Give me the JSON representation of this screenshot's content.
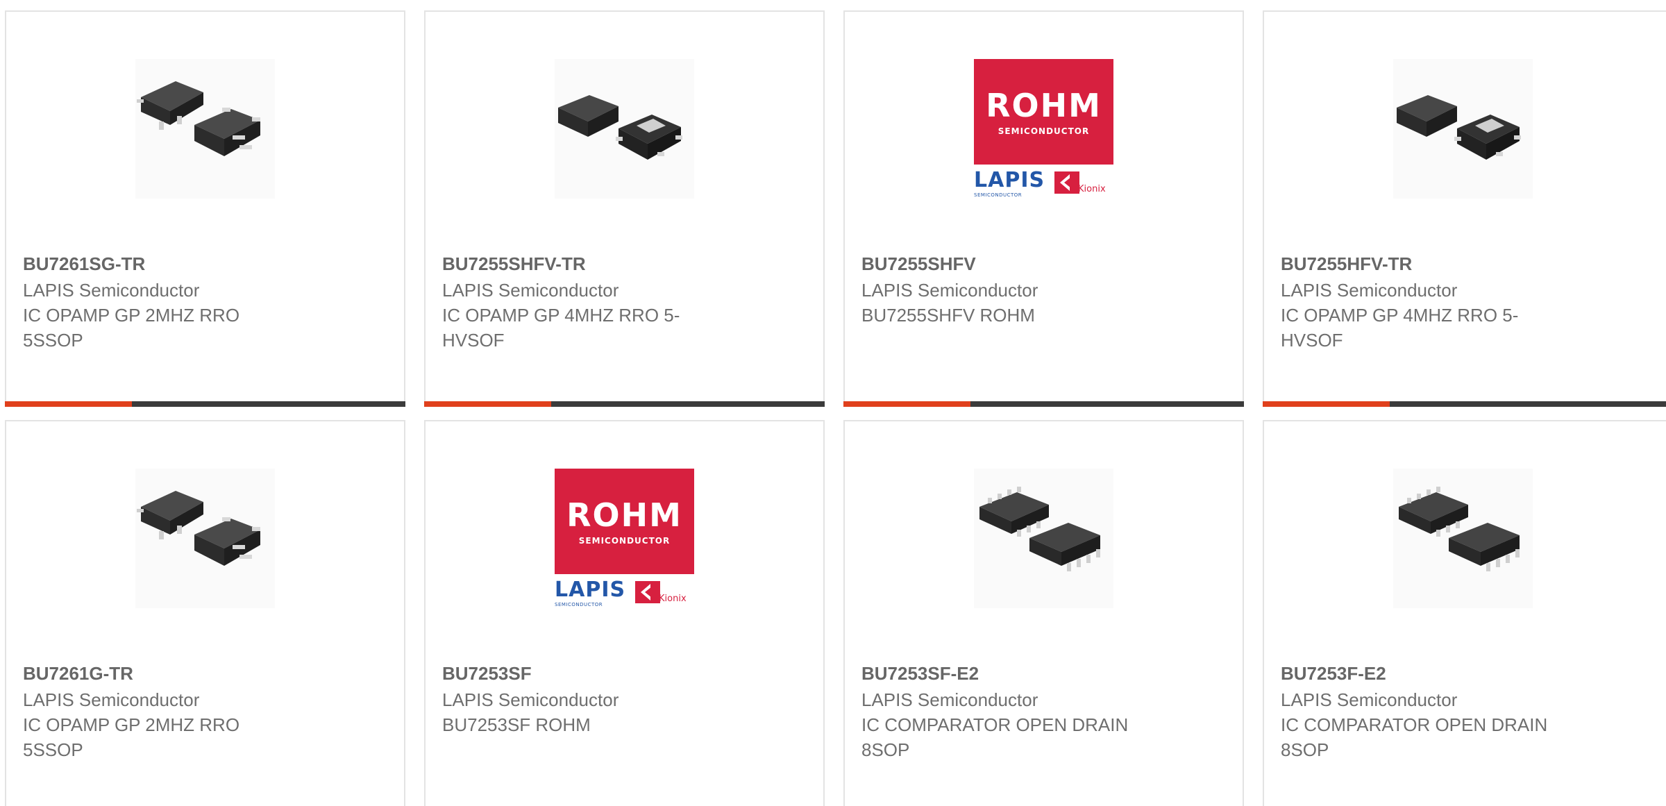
{
  "products": [
    {
      "part": "BU7261SG-TR",
      "manufacturer": "LAPIS Semiconductor",
      "description": "IC OPAMP GP 2MHZ RRO 5SSOP",
      "image": "sot23-5-chip-icon"
    },
    {
      "part": "BU7255SHFV-TR",
      "manufacturer": "LAPIS Semiconductor",
      "description": "IC OPAMP GP 4MHZ RRO 5-HVSOF",
      "image": "hvsof-5-chip-icon"
    },
    {
      "part": "BU7255SHFV",
      "manufacturer": "LAPIS Semiconductor",
      "description": "BU7255SHFV ROHM",
      "image": "rohm-logo"
    },
    {
      "part": "BU7255HFV-TR",
      "manufacturer": "LAPIS Semiconductor",
      "description": "IC OPAMP GP 4MHZ RRO 5-HVSOF",
      "image": "hvsof-5-chip-icon"
    },
    {
      "part": "BU7261G-TR",
      "manufacturer": "LAPIS Semiconductor",
      "description": "IC OPAMP GP 2MHZ RRO 5SSOP",
      "image": "sot23-5-chip-icon"
    },
    {
      "part": "BU7253SF",
      "manufacturer": "LAPIS Semiconductor",
      "description": "BU7253SF ROHM",
      "image": "rohm-logo"
    },
    {
      "part": "BU7253SF-E2",
      "manufacturer": "LAPIS Semiconductor",
      "description": "IC COMPARATOR OPEN DRAIN 8SOP",
      "image": "sop-8-chip-icon"
    },
    {
      "part": "BU7253F-E2",
      "manufacturer": "LAPIS Semiconductor",
      "description": "IC COMPARATOR OPEN DRAIN 8SOP",
      "image": "sop-8-chip-icon"
    }
  ],
  "logo": {
    "rohm": "ROHM",
    "semiconductor": "SEMICONDUCTOR",
    "lapis": "LAPIS",
    "lapis_sub": "SEMICONDUCTOR",
    "kionix": "Kionix"
  },
  "colors": {
    "accent": "#e0401c",
    "bar": "#3b3b3b",
    "rohm_red": "#d7203f",
    "lapis_blue": "#2357a8"
  }
}
